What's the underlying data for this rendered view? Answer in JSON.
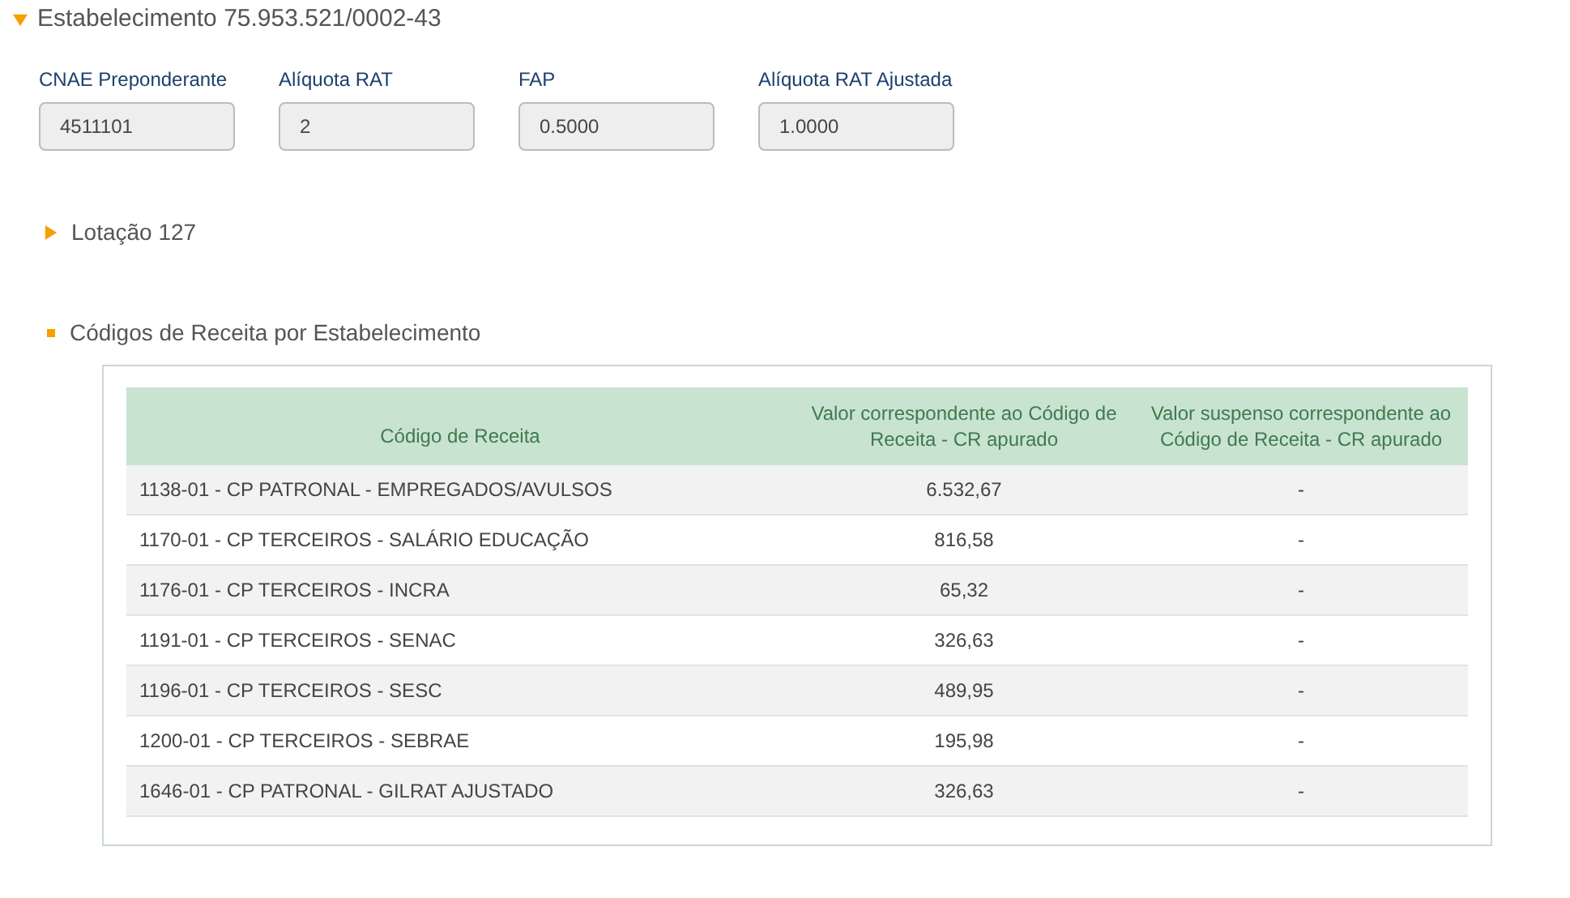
{
  "establishment": {
    "title": "Estabelecimento 75.953.521/0002-43",
    "expanded": true,
    "fields": [
      {
        "label": "CNAE Preponderante",
        "value": "4511101"
      },
      {
        "label": "Alíquota RAT",
        "value": "2"
      },
      {
        "label": "FAP",
        "value": "0.5000"
      },
      {
        "label": "Alíquota RAT Ajustada",
        "value": "1.0000"
      }
    ]
  },
  "lotacao": {
    "title": "Lotação 127",
    "expanded": false
  },
  "codigos": {
    "title": "Códigos de Receita por Estabelecimento",
    "table": {
      "columns": [
        "Código de Receita",
        "Valor correspondente ao Código de Receita - CR apurado",
        "Valor suspenso correspondente ao Código de Receita - CR apurado"
      ],
      "rows": [
        [
          "1138-01 - CP PATRONAL - EMPREGADOS/AVULSOS",
          "6.532,67",
          "-"
        ],
        [
          "1170-01 - CP TERCEIROS - SALÁRIO EDUCAÇÃO",
          "816,58",
          "-"
        ],
        [
          "1176-01 - CP TERCEIROS - INCRA",
          "65,32",
          "-"
        ],
        [
          "1191-01 - CP TERCEIROS - SENAC",
          "326,63",
          "-"
        ],
        [
          "1196-01 - CP TERCEIROS - SESC",
          "489,95",
          "-"
        ],
        [
          "1200-01 - CP TERCEIROS - SEBRAE",
          "195,98",
          "-"
        ],
        [
          "1646-01 - CP PATRONAL - GILRAT AJUSTADO",
          "326,63",
          "-"
        ]
      ]
    }
  }
}
